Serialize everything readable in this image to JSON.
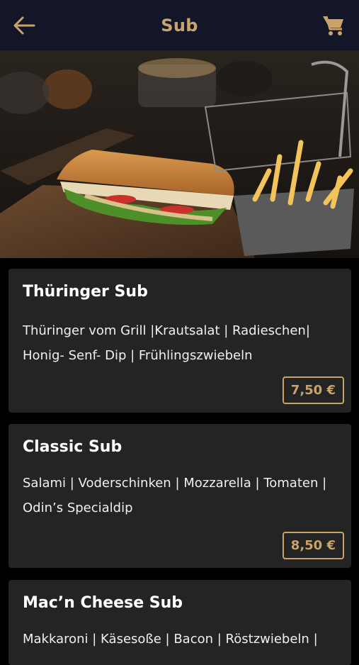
{
  "header": {
    "title": "Sub",
    "back_icon": "arrow-left-icon",
    "cart_icon": "shopping-cart-icon"
  },
  "colors": {
    "accent": "#c9a36a",
    "header_bg": "#131628",
    "card_bg": "#242424"
  },
  "items": [
    {
      "name": "Thüringer Sub",
      "desc_line1": "Thüringer vom Grill |Krautsalat | Radieschen|",
      "desc_line2": "Honig- Senf- Dip | Frühlingszwiebeln",
      "price": "7,50 €"
    },
    {
      "name": "Classic Sub",
      "desc_line1": "Salami | Voderschinken | Mozzarella | Tomaten |",
      "desc_line2": "Odin’s Specialdip",
      "price": "8,50 €"
    },
    {
      "name": "Mac’n Cheese Sub",
      "desc_line1": "Makkaroni | Käsesoße | Bacon | Röstzwiebeln |"
    }
  ]
}
